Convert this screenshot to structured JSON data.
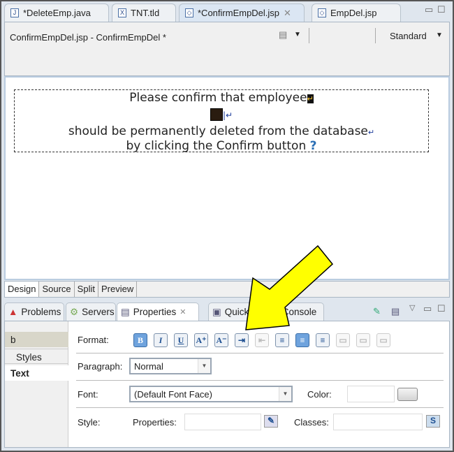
{
  "editor_tabs": [
    {
      "label": "*DeleteEmp.java",
      "icon": "java-file-icon",
      "glyph": "J"
    },
    {
      "label": "TNT.tld",
      "icon": "xml-file-icon",
      "glyph": "X"
    },
    {
      "label": "*ConfirmEmpDel.jsp",
      "icon": "jsp-file-icon",
      "glyph": "◇",
      "active": true
    },
    {
      "label": "EmpDel.jsp",
      "icon": "jsp-file-icon",
      "glyph": "◇"
    }
  ],
  "editor": {
    "title": "ConfirmEmpDel.jsp - ConfirmEmpDel *",
    "device": "Standard"
  },
  "design": {
    "line1": "Please confirm that employee",
    "line3": "should be permanently deleted from the database",
    "line4": "by clicking the Confirm button",
    "unknown_tag_marker": "?"
  },
  "mode_tabs": [
    "Design",
    "Source",
    "Split",
    "Preview"
  ],
  "panel_tabs": [
    {
      "label": "Problems",
      "icon": "problems-icon"
    },
    {
      "label": "Servers",
      "icon": "servers-icon"
    },
    {
      "label": "Properties",
      "icon": "properties-icon",
      "active": true
    },
    {
      "label": "Quick",
      "icon": "quick-edit-icon"
    },
    {
      "label": "Console",
      "icon": "console-icon"
    }
  ],
  "properties": {
    "side_items": [
      "b",
      "Styles",
      "Text"
    ],
    "selected_side": "Text",
    "format_label": "Format:",
    "format_buttons": [
      {
        "name": "bold",
        "glyph": "B",
        "state": "on"
      },
      {
        "name": "italic",
        "glyph": "I",
        "state": "normal"
      },
      {
        "name": "underline",
        "glyph": "U",
        "state": "normal"
      },
      {
        "name": "font-larger",
        "glyph": "A⁺",
        "state": "normal"
      },
      {
        "name": "font-smaller",
        "glyph": "A⁻",
        "state": "normal"
      },
      {
        "name": "indent",
        "glyph": "⇥",
        "state": "normal"
      },
      {
        "name": "outdent",
        "glyph": "⇤",
        "state": "disabled"
      },
      {
        "name": "align-left",
        "glyph": "≡",
        "state": "normal"
      },
      {
        "name": "align-center",
        "glyph": "≡",
        "state": "on"
      },
      {
        "name": "align-right",
        "glyph": "≡",
        "state": "normal"
      },
      {
        "name": "justify-top",
        "glyph": "▭",
        "state": "disabled"
      },
      {
        "name": "justify-middle",
        "glyph": "▭",
        "state": "disabled"
      },
      {
        "name": "justify-bottom",
        "glyph": "▭",
        "state": "disabled"
      }
    ],
    "paragraph_label": "Paragraph:",
    "paragraph_value": "Normal",
    "font_label": "Font:",
    "font_value": "(Default Font Face)",
    "color_label": "Color:",
    "color_value": "",
    "style_label": "Style:",
    "properties_label": "Properties:",
    "properties_value": "",
    "classes_label": "Classes:",
    "classes_value": ""
  },
  "colors": {
    "arrow": "#ffff00",
    "accent": "#6fa3dd"
  }
}
